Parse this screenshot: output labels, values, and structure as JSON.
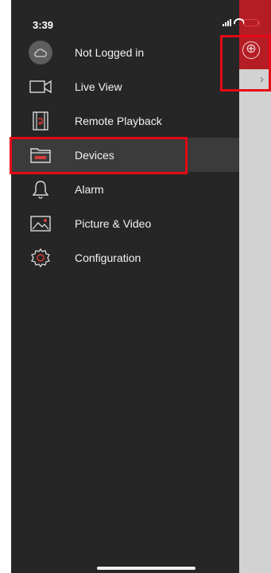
{
  "status_bar": {
    "time": "3:39"
  },
  "menu": {
    "items": [
      {
        "label": "Not Logged in",
        "icon": "cloud-icon"
      },
      {
        "label": "Live View",
        "icon": "video-camera-icon"
      },
      {
        "label": "Remote Playback",
        "icon": "film-playback-icon"
      },
      {
        "label": "Devices",
        "icon": "folder-devices-icon",
        "active": true
      },
      {
        "label": "Alarm",
        "icon": "bell-icon"
      },
      {
        "label": "Picture & Video",
        "icon": "picture-icon"
      },
      {
        "label": "Configuration",
        "icon": "gear-icon"
      }
    ]
  },
  "underlay": {
    "add_glyph": "⊕",
    "chevron": "›"
  },
  "colors": {
    "accent": "#b51d25",
    "drawer_bg": "#262626",
    "highlight": "#e50914"
  }
}
